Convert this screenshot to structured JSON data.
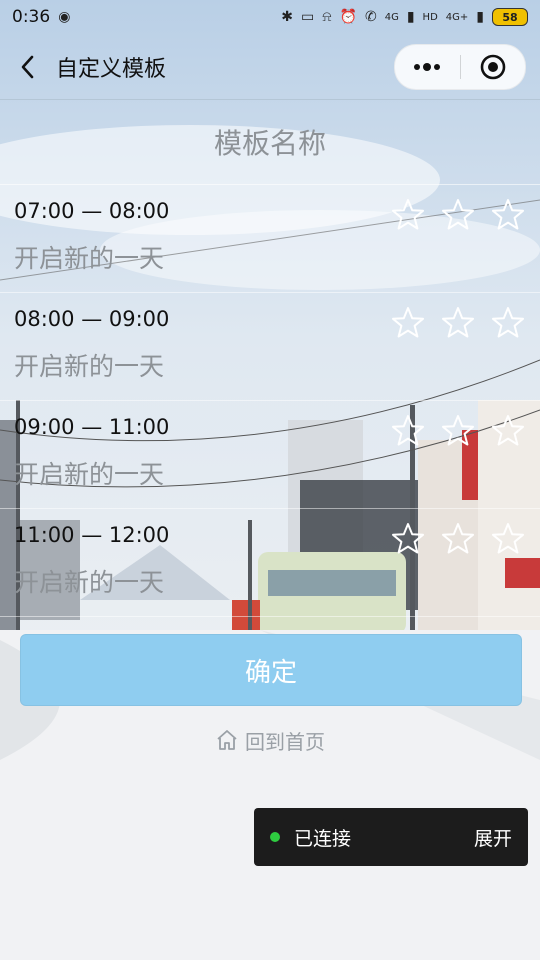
{
  "status_bar": {
    "time": "0:36",
    "battery": "58",
    "net_1": "4G",
    "net_2": "HD",
    "net_3": "4G+"
  },
  "nav": {
    "title": "自定义模板"
  },
  "template": {
    "name_placeholder": "模板名称"
  },
  "slots": [
    {
      "time": "07:00 — 08:00",
      "desc": "开启新的一天",
      "stars": 3
    },
    {
      "time": "08:00 — 09:00",
      "desc": "开启新的一天",
      "stars": 3
    },
    {
      "time": "09:00 — 11:00",
      "desc": "开启新的一天",
      "stars": 3
    },
    {
      "time": "11:00 — 12:00",
      "desc": "开启新的一天",
      "stars": 3
    }
  ],
  "actions": {
    "confirm_label": "确定",
    "home_label": "回到首页"
  },
  "toast": {
    "status": "已连接",
    "action": "展开",
    "dot_color": "#2ecc40"
  },
  "colors": {
    "confirm_bg": "#8fcdf0",
    "placeholder_text": "#8d9297"
  }
}
